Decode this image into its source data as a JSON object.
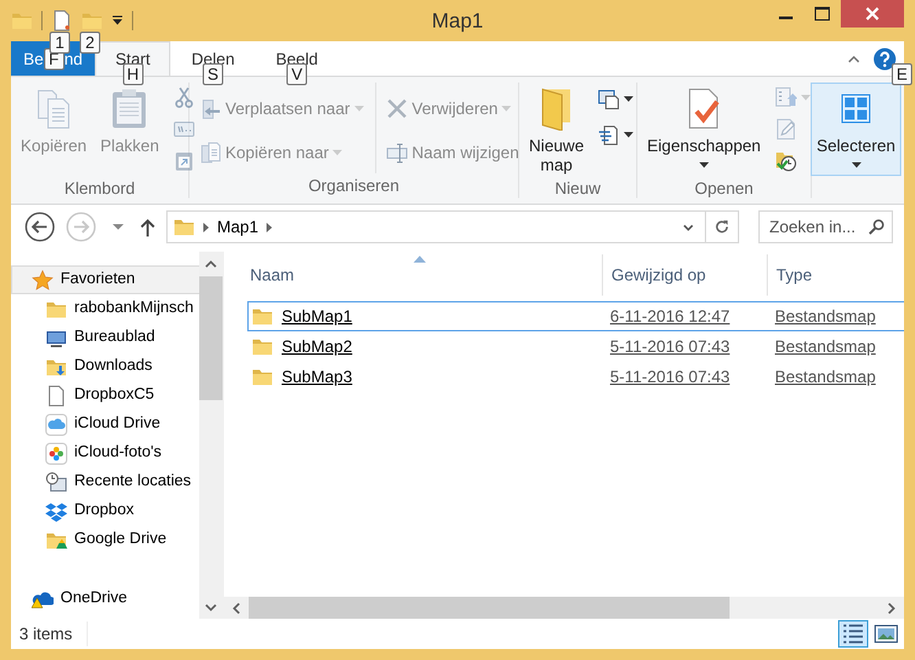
{
  "window": {
    "title": "Map1"
  },
  "quick_access": [
    {
      "kind": "new-file",
      "keytip": "1"
    },
    {
      "kind": "new-folder",
      "keytip": "2"
    }
  ],
  "tabs": [
    {
      "kind": "file",
      "label": [
        "Be",
        "nd"
      ],
      "keytip": "F",
      "selected": false
    },
    {
      "kind": "tab",
      "label": "Start",
      "keytip": "H",
      "selected": true
    },
    {
      "kind": "tab",
      "label": "Delen",
      "keytip": "S",
      "selected": false
    },
    {
      "kind": "tab",
      "label": "Beeld",
      "keytip": "V",
      "selected": false
    }
  ],
  "help": {
    "keytip": "E"
  },
  "ribbon": [
    {
      "label": "Klembord",
      "columns": [
        [
          {
            "kind": "copy",
            "label": "Kopiëren",
            "disabled": true
          }
        ],
        [
          {
            "kind": "paste",
            "label": "Plakken",
            "disabled": true
          }
        ],
        [
          {
            "kind": "cut",
            "disabled": true
          },
          {
            "kind": "copy-path",
            "disabled": true
          },
          {
            "kind": "paste-shortcut",
            "disabled": true
          }
        ]
      ]
    },
    {
      "label": "Organiseren",
      "columns": [
        [
          {
            "kind": "move",
            "label": "Verplaatsen naar",
            "dropdown": true,
            "disabled": true
          },
          {
            "kind": "copy-to",
            "label": "Kopiëren naar",
            "dropdown": true,
            "disabled": true
          }
        ],
        [
          {
            "kind": "delete",
            "label": "Verwijderen",
            "dropdown": true,
            "disabled": true
          },
          {
            "kind": "rename",
            "label": "Naam wijzigen",
            "disabled": true
          }
        ]
      ]
    },
    {
      "label": "Nieuw",
      "columns": [
        [
          {
            "kind": "new-folder",
            "label": "Nieuwe map",
            "disabled": false
          }
        ],
        [
          {
            "kind": "new-item",
            "dropdown": true,
            "disabled": false
          },
          {
            "kind": "easy-access",
            "dropdown": true,
            "disabled": false
          }
        ]
      ]
    },
    {
      "label": "Openen",
      "columns": [
        [
          {
            "kind": "properties",
            "label": "Eigenschappen",
            "dropdown": true,
            "disabled": false
          }
        ],
        [
          {
            "kind": "open",
            "dropdown": true,
            "disabled": true
          },
          {
            "kind": "edit",
            "disabled": true
          },
          {
            "kind": "history",
            "disabled": false
          }
        ]
      ]
    },
    {
      "columns": [
        [
          {
            "kind": "select",
            "label": "Selecteren",
            "dropdown": true,
            "disabled": false,
            "highlighted": true
          }
        ]
      ]
    }
  ],
  "address": {
    "path": [
      "Map1"
    ],
    "back_disabled": false,
    "forward_disabled": true,
    "search": {
      "placeholder": "Zoeken in..."
    }
  },
  "navigation": [
    {
      "kind": "star",
      "label": "Favorieten",
      "selected": true,
      "children": [
        {
          "kind": "folder",
          "label": "rabobankMijnsch",
          "selected": false
        },
        {
          "kind": "desktop",
          "label": "Bureaublad",
          "selected": false
        },
        {
          "kind": "downloads",
          "label": "Downloads",
          "selected": false
        },
        {
          "kind": "file",
          "label": "DropboxC5",
          "selected": false
        },
        {
          "kind": "cloud",
          "label": "iCloud Drive",
          "selected": false
        },
        {
          "kind": "photos",
          "label": "iCloud-foto's",
          "selected": false
        },
        {
          "kind": "recent",
          "label": "Recente locaties",
          "selected": false
        },
        {
          "kind": "dropbox",
          "label": "Dropbox",
          "selected": false
        },
        {
          "kind": "gdrive",
          "label": "Google Drive",
          "selected": false
        }
      ]
    },
    {
      "kind": "onedrive",
      "label": "OneDrive",
      "selected": false
    }
  ],
  "table": {
    "columns": [
      {
        "label": "Naam",
        "sorted": true
      },
      {
        "label": "Gewijzigd op",
        "sorted": false
      },
      {
        "label": "Type",
        "sorted": false
      }
    ],
    "rows": [
      {
        "name": "SubMap1",
        "modified": "6-11-2016 12:47",
        "type": "Bestandsmap",
        "selected": true
      },
      {
        "name": "SubMap2",
        "modified": "5-11-2016 07:43",
        "type": "Bestandsmap",
        "selected": false
      },
      {
        "name": "SubMap3",
        "modified": "5-11-2016 07:43",
        "type": "Bestandsmap",
        "selected": false
      }
    ]
  },
  "status_bar": {
    "text": "3 items",
    "views": [
      {
        "kind": "details",
        "selected": true
      },
      {
        "kind": "large-icons",
        "selected": false
      }
    ]
  }
}
